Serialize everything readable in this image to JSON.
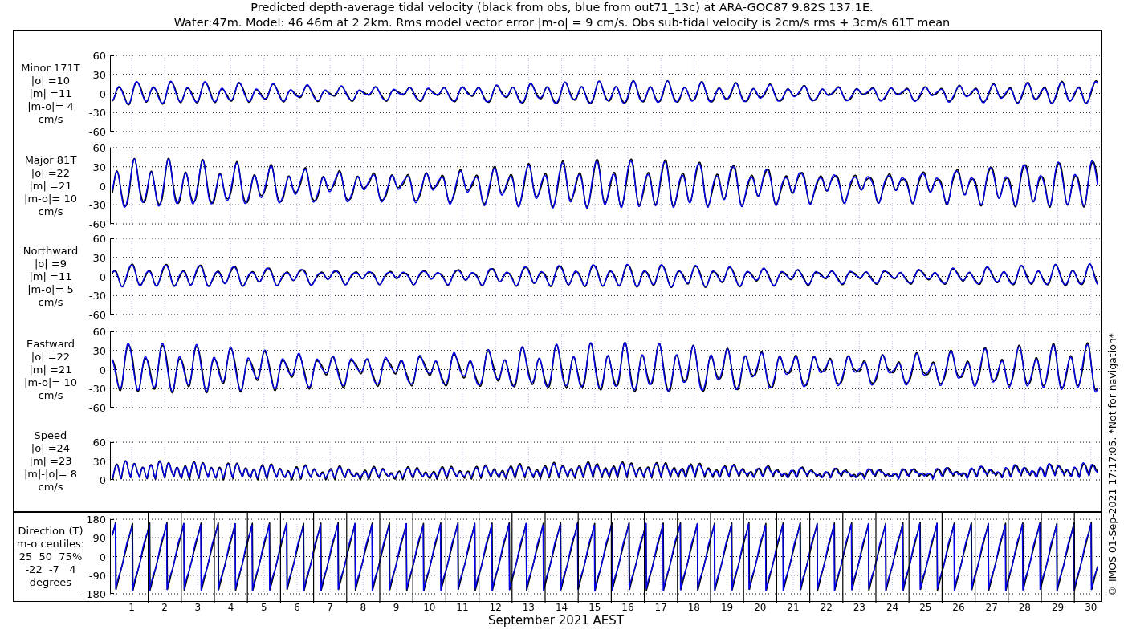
{
  "title_lines": [
    "Predicted depth-average tidal velocity (black from obs, blue from out71_13c) at ARA-GOC87 9.82S 137.1E.",
    "Water:47m. Model: 46 46m at 2 2km. Rms model vector error |m-o| = 9 cm/s. Obs sub-tidal velocity is 2cm/s rms + 3cm/s 61T mean"
  ],
  "panels": [
    {
      "kind": "velocity",
      "label_lines": [
        "Minor 171T",
        "|o| =10",
        "|m| =11",
        "|m-o|= 4",
        "cm/s"
      ],
      "yticks": [
        "60",
        "30",
        "0",
        "-30",
        "-60"
      ]
    },
    {
      "kind": "velocity",
      "label_lines": [
        "Major 81T",
        "|o| =22",
        "|m| =21",
        "|m-o|= 10",
        "cm/s"
      ],
      "yticks": [
        "60",
        "30",
        "0",
        "-30",
        "-60"
      ]
    },
    {
      "kind": "velocity",
      "label_lines": [
        "Northward",
        "|o| =9",
        "|m| =11",
        "|m-o|= 5",
        "cm/s"
      ],
      "yticks": [
        "60",
        "30",
        "0",
        "-30",
        "-60"
      ]
    },
    {
      "kind": "velocity",
      "label_lines": [
        "Eastward",
        "|o| =22",
        "|m| =21",
        "|m-o|= 10",
        "cm/s"
      ],
      "yticks": [
        "60",
        "30",
        "0",
        "-30",
        "-60"
      ]
    },
    {
      "kind": "speed",
      "label_lines": [
        "Speed",
        "|o| =24",
        "|m| =23",
        "|m|-|o|= 8",
        "cm/s"
      ],
      "yticks": [
        "60",
        "30",
        "0"
      ]
    },
    {
      "kind": "direction",
      "label_lines": [
        "Direction (T)",
        "m-o centiles:",
        "25  50  75%",
        "-22  -7   4",
        "degrees"
      ],
      "yticks": [
        "180",
        "90",
        "0",
        "-90",
        "-180"
      ]
    }
  ],
  "xticks": [
    "1",
    "2",
    "3",
    "4",
    "5",
    "6",
    "7",
    "8",
    "9",
    "10",
    "11",
    "12",
    "13",
    "14",
    "15",
    "16",
    "17",
    "18",
    "19",
    "20",
    "21",
    "22",
    "23",
    "24",
    "25",
    "26",
    "27",
    "28",
    "29",
    "30"
  ],
  "xlabel": "September 2021 AEST",
  "credit": "© IMOS 01-Sep-2021 17:17:05. *Not for navigation*"
}
